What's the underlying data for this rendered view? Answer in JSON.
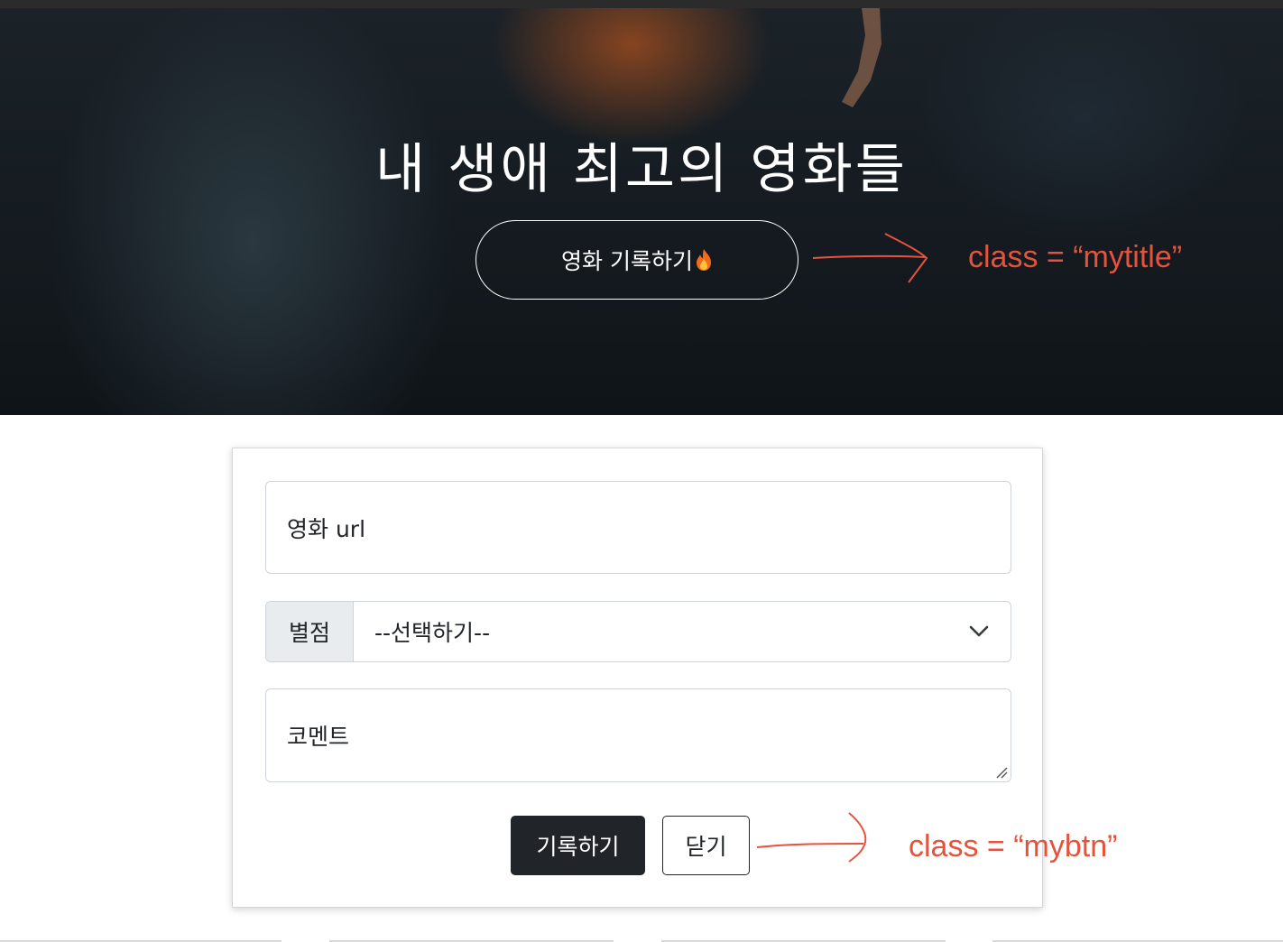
{
  "hero": {
    "title": "내 생애 최고의 영화들",
    "button_label": "영화 기록하기",
    "button_icon": "fire-icon"
  },
  "annotations": {
    "title_note": "class = “mytitle”",
    "button_note": "class = “mybtn”",
    "color": "#e5533d"
  },
  "form": {
    "url_placeholder": "영화 url",
    "rating_label": "별점",
    "rating_selected": "--선택하기--",
    "comment_placeholder": "코멘트",
    "save_label": "기록하기",
    "close_label": "닫기"
  },
  "colors": {
    "dark_button": "#212529",
    "addon_bg": "#e9ecef",
    "border": "#ced4da"
  }
}
